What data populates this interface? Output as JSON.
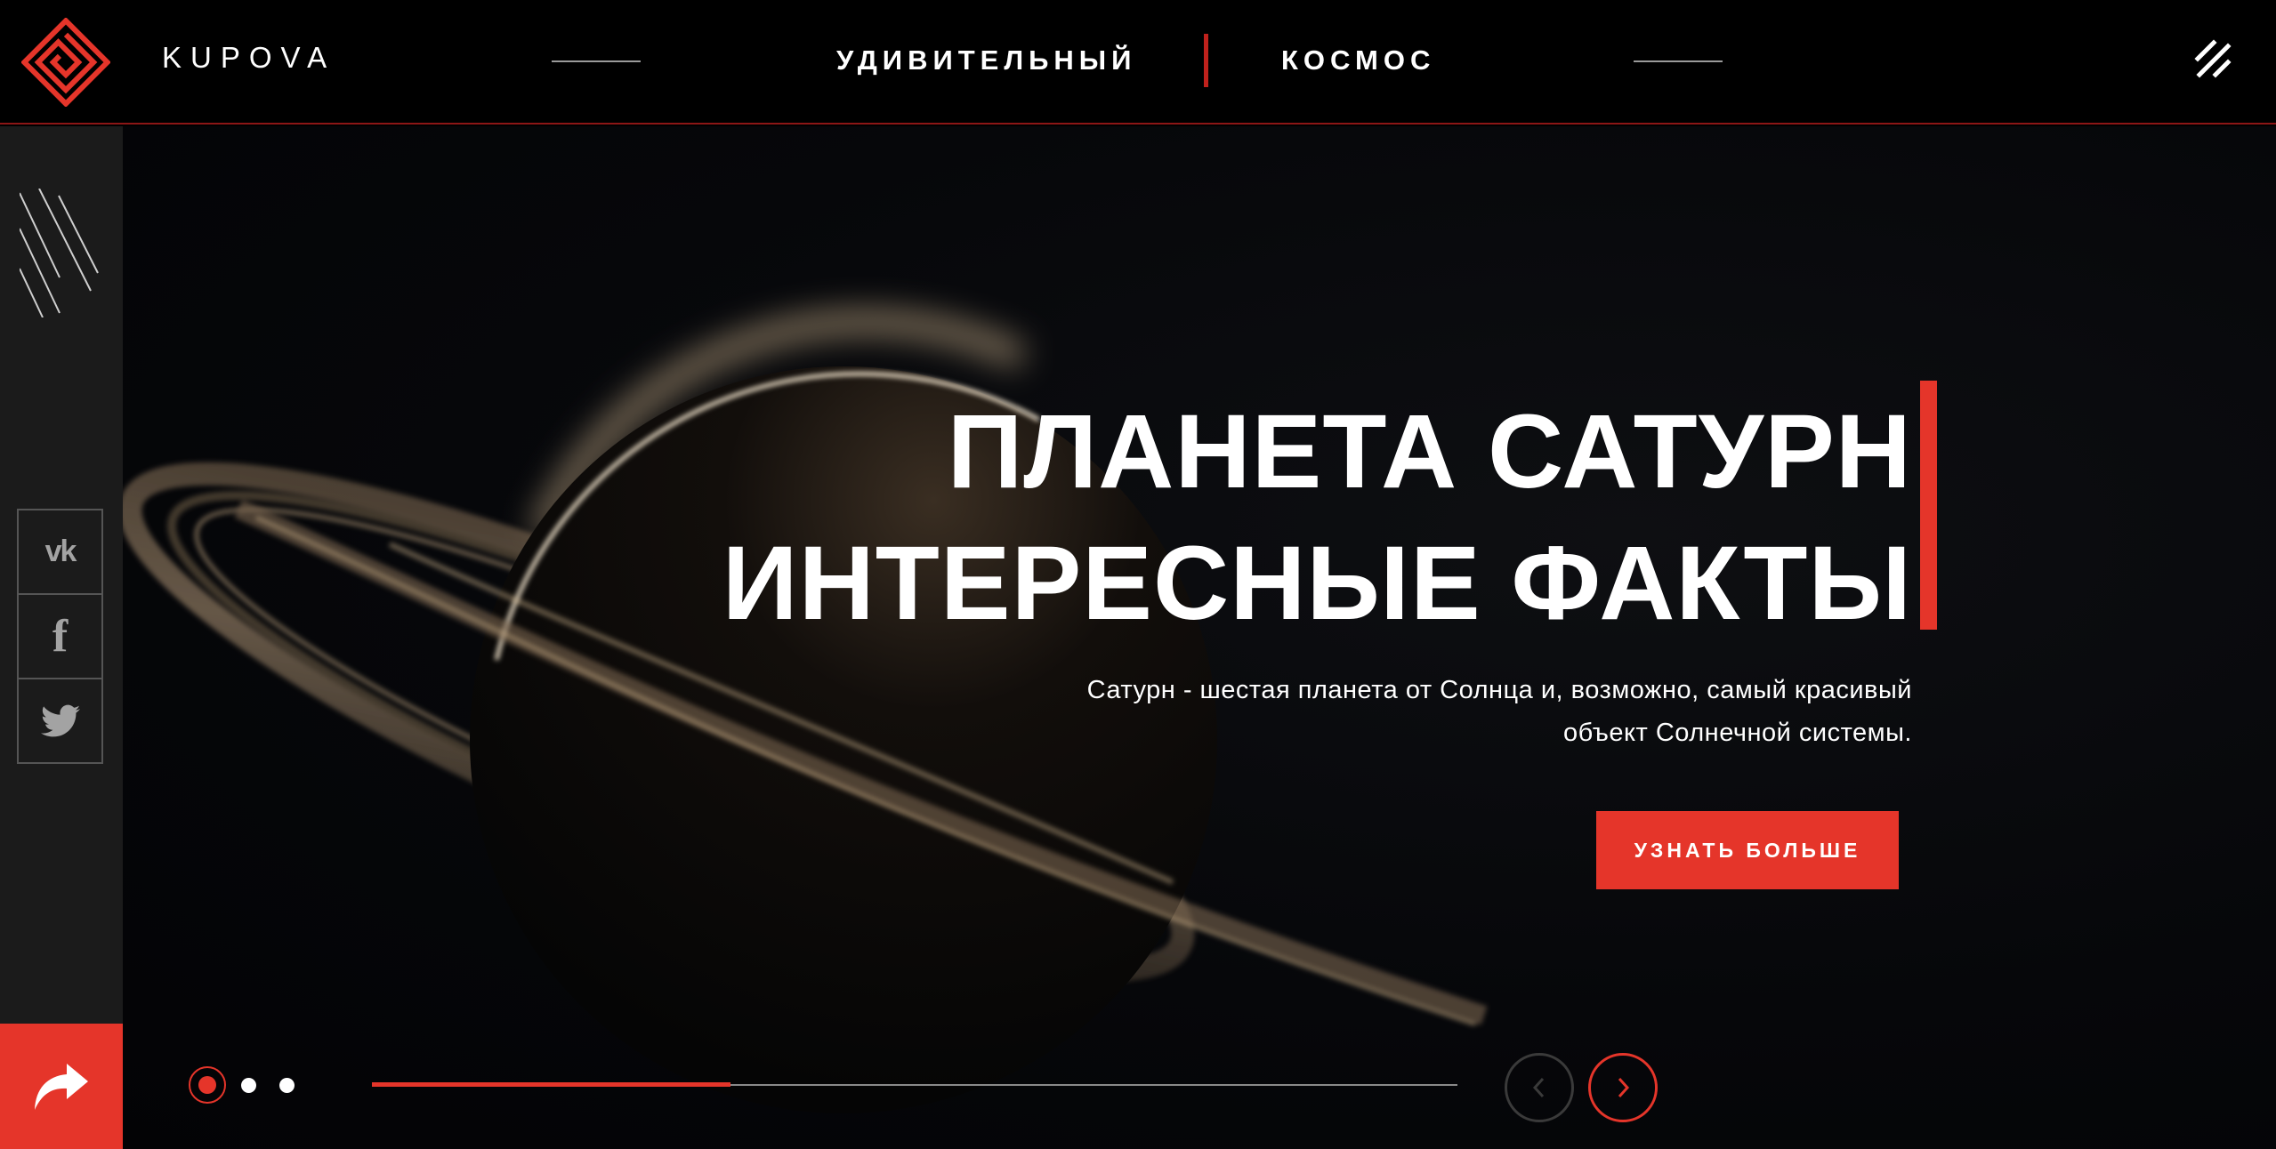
{
  "header": {
    "brand": "KUPOVA",
    "nav": [
      "УДИВИТЕЛЬНЫЙ",
      "КОСМОС"
    ],
    "logo_icon": "diamond-maze-logo-icon",
    "menu_icon": "double-slash-menu-icon"
  },
  "sidebar": {
    "socials": [
      {
        "name": "vk",
        "glyph": "vk"
      },
      {
        "name": "facebook",
        "glyph": "f"
      },
      {
        "name": "twitter",
        "icon": "twitter-bird-icon"
      }
    ],
    "share_icon": "share-arrow-icon"
  },
  "hero": {
    "title_line1": "ПЛАНЕТА САТУРН",
    "title_line2": "ИНТЕРЕСНЫЕ ФАКТЫ",
    "description_line1": "Сатурн - шестая планета от Солнца и, возможно, самый красивый",
    "description_line2": "объект Солнечной системы.",
    "cta_label": "УЗНАТЬ БОЛЬШЕ"
  },
  "slider": {
    "slides_total": 3,
    "active_slide": 1,
    "progress": 0.33
  },
  "colors": {
    "accent": "#e5352a",
    "background": "#000000",
    "sidebar": "#1b1b1b"
  }
}
